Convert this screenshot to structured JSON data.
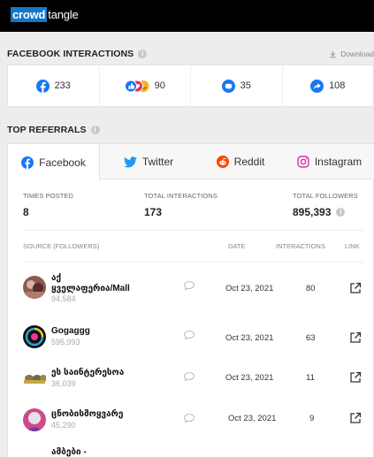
{
  "brand": {
    "part1": "crowd",
    "part2": "tangle"
  },
  "facebook_interactions": {
    "title": "FACEBOOK INTERACTIONS",
    "info": "i",
    "download_label": "Download",
    "stats": [
      {
        "icon": "facebook-icon",
        "value": "233"
      },
      {
        "icon": "reactions-icon",
        "value": "90"
      },
      {
        "icon": "comment-icon",
        "value": "35"
      },
      {
        "icon": "share-icon",
        "value": "108"
      }
    ]
  },
  "top_referrals": {
    "title": "TOP REFERRALS",
    "info": "i",
    "tabs": [
      {
        "label": "Facebook",
        "icon": "facebook-icon",
        "active": true
      },
      {
        "label": "Twitter",
        "icon": "twitter-icon"
      },
      {
        "label": "Reddit",
        "icon": "reddit-icon"
      },
      {
        "label": "Instagram",
        "icon": "instagram-icon"
      }
    ],
    "summary": {
      "times_posted_label": "TIMES POSTED",
      "times_posted": "8",
      "total_interactions_label": "TOTAL INTERACTIONS",
      "total_interactions": "173",
      "total_followers_label": "TOTAL FOLLOWERS",
      "total_followers": "895,393"
    },
    "columns": {
      "source": "SOURCE (FOLLOWERS)",
      "date": "DATE",
      "interactions": "INTERACTIONS",
      "link": "LINK"
    },
    "rows": [
      {
        "name_line1": "აქ",
        "name_line2": "ყველაფერია/Mall",
        "followers": "94,584",
        "date": "Oct 23, 2021",
        "interactions": "80"
      },
      {
        "name_line1": "Gogaggg",
        "followers": "595,993",
        "date": "Oct 23, 2021",
        "interactions": "63"
      },
      {
        "name_line1": "ეს საინტერესოა",
        "followers": "36,039",
        "date": "Oct 23, 2021",
        "interactions": "11"
      },
      {
        "name_line1": "ცნობისმოყვარე",
        "followers": "45,290",
        "date": "Oct 23, 2021",
        "interactions": "9"
      },
      {
        "name_line1": "ამბები -"
      }
    ]
  }
}
